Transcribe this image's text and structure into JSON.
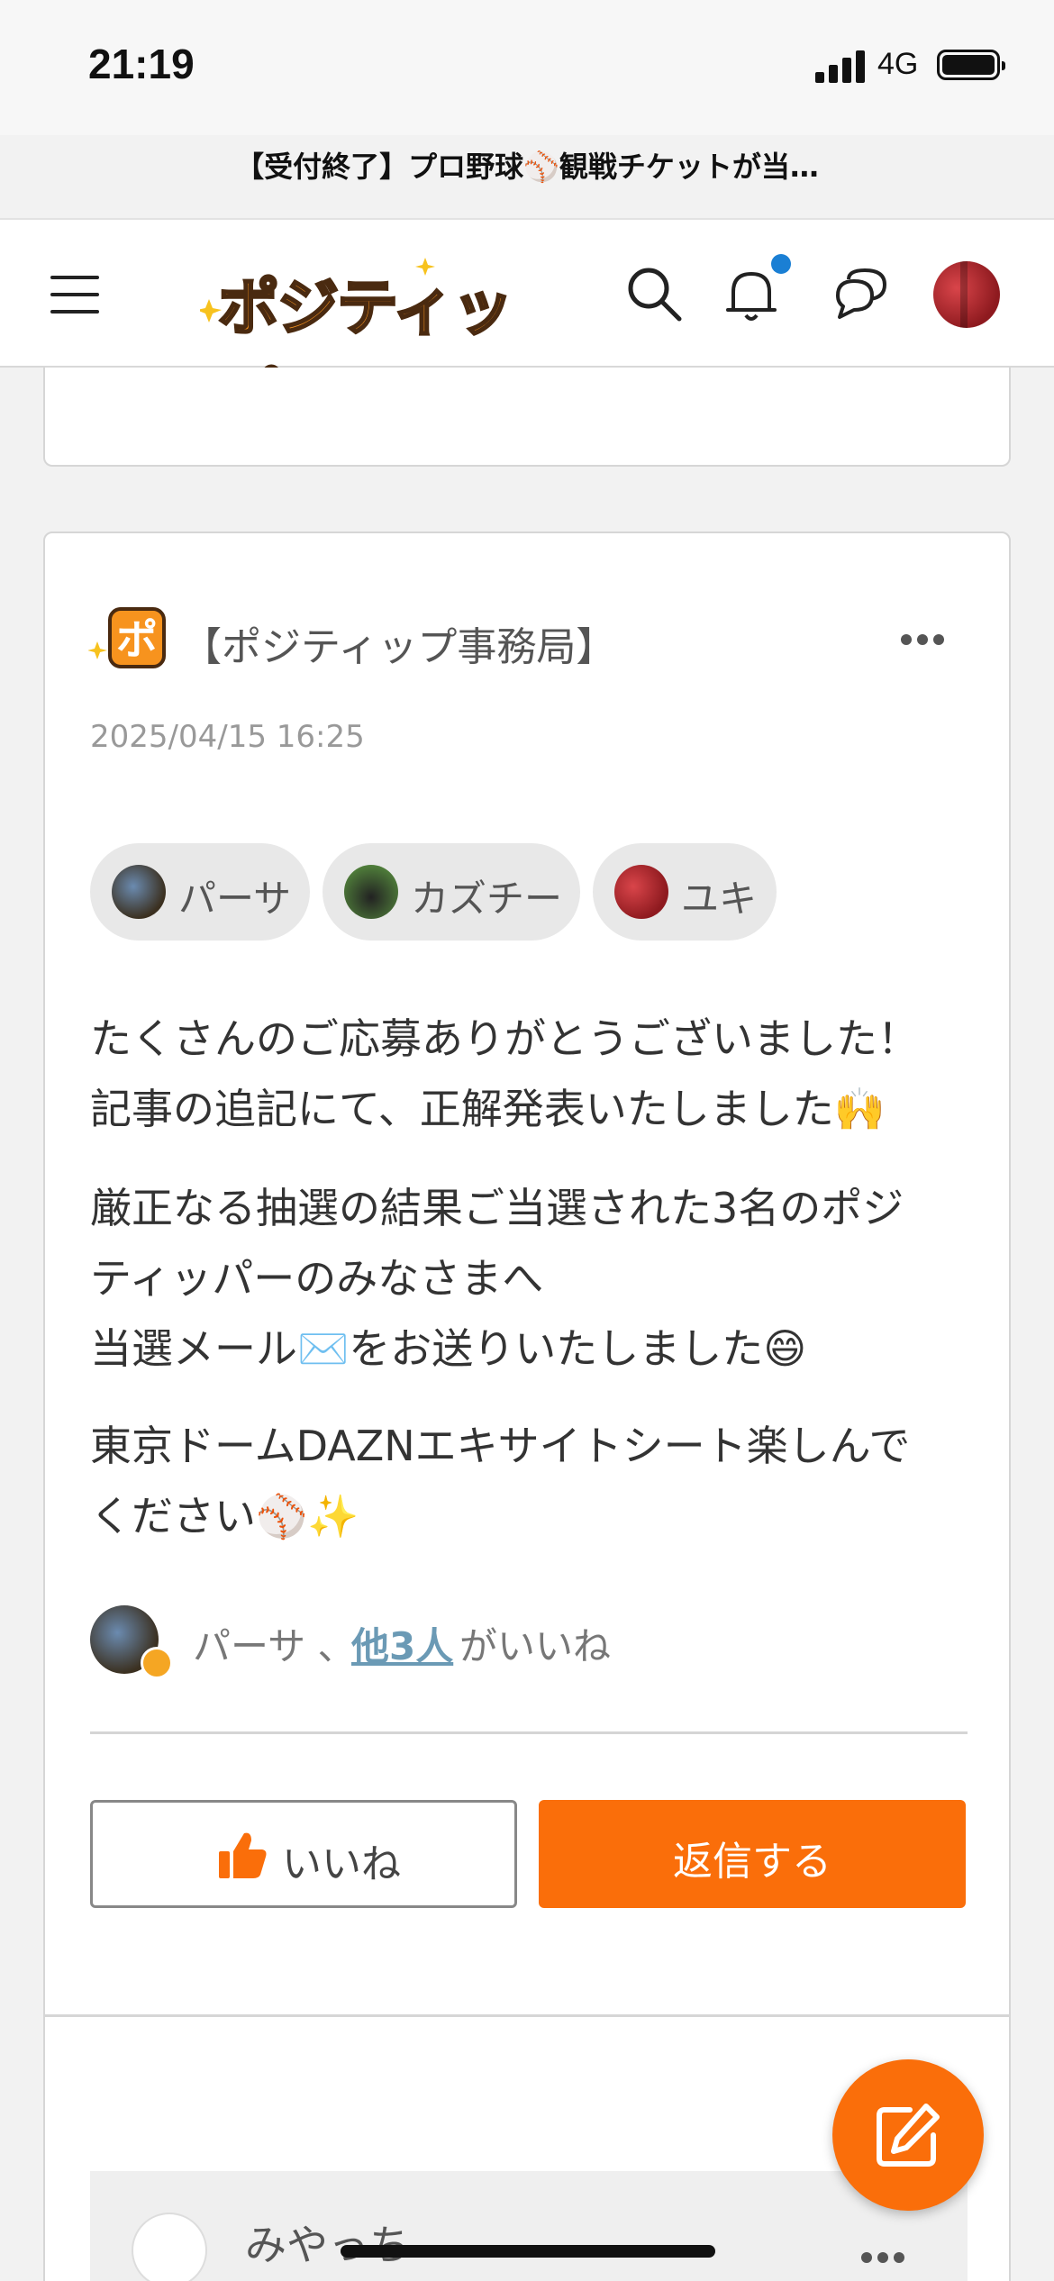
{
  "status_bar": {
    "time": "21:19",
    "network": "4G"
  },
  "page_title": "【受付終了】プロ野球⚾観戦チケットが当…",
  "header": {
    "logo_text": "ポジティップ",
    "icons": [
      "menu-icon",
      "search-icon",
      "bell-icon",
      "chat-icon",
      "avatar"
    ]
  },
  "post": {
    "author": "【ポジティップ事務局】",
    "date": "2025/04/15 16:25",
    "mentions": [
      {
        "name": "パーサ"
      },
      {
        "name": "カズチー"
      },
      {
        "name": "ユキ"
      }
    ],
    "paragraphs": [
      {
        "lines": [
          "たくさんのご応募ありがとうございました！",
          "記事の追記にて、正解発表いたしました🙌"
        ]
      },
      {
        "lines": [
          "厳正なる抽選の結果ご当選された3名のポジ",
          "ティッパーのみなさまへ",
          "当選メール✉️をお送りいたしました😄"
        ]
      },
      {
        "lines": [
          "東京ドームDAZNエキサイトシート楽しんで",
          "ください⚾✨"
        ]
      }
    ],
    "likes": {
      "name": "パーサ 、",
      "others": "他3人",
      "suffix": "がいいね"
    },
    "like_button": "いいね",
    "reply_button": "返信する"
  },
  "reply_preview": {
    "name": "みやっち"
  },
  "colors": {
    "accent": "#fa6e0a",
    "link": "#6b9ab5",
    "notif": "#1a7fd4"
  }
}
